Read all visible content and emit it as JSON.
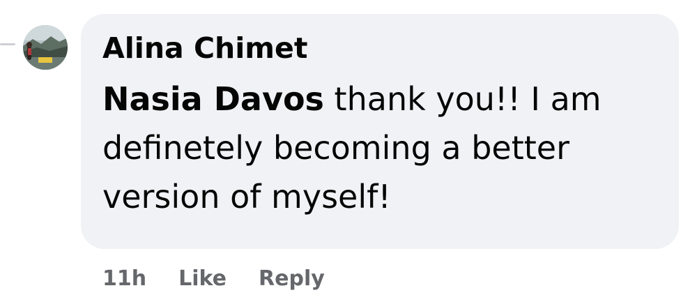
{
  "comment": {
    "author": "Alina Chimet",
    "mention": "Nasia Davos",
    "text": " thank you!! I am definetely becoming a better version of myself!",
    "avatar_icon": "user-avatar-photo",
    "colors": {
      "bubble": "#f0f2f5",
      "text": "#050505",
      "meta": "#65676b"
    }
  },
  "actions": {
    "timestamp": "11h",
    "like_label": "Like",
    "reply_label": "Reply"
  }
}
